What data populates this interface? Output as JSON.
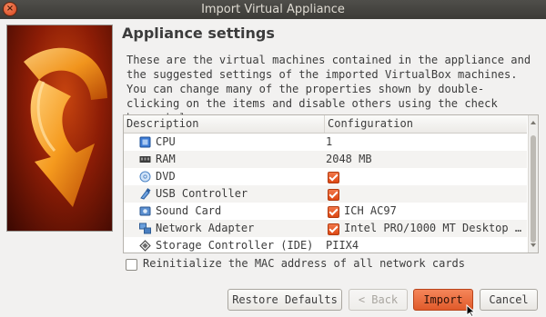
{
  "window": {
    "title": "Import Virtual Appliance",
    "close_glyph": "×"
  },
  "page": {
    "heading": "Appliance settings",
    "description": "These are the virtual machines contained in the appliance and the suggested settings of the imported VirtualBox machines. You can change many of the properties shown by double-clicking on the items and disable others using the check boxes below."
  },
  "table": {
    "columns": [
      "Description",
      "Configuration"
    ],
    "rows": [
      {
        "icon": "cpu-icon",
        "label": "CPU",
        "value": "1",
        "checked": null
      },
      {
        "icon": "ram-icon",
        "label": "RAM",
        "value": "2048 MB",
        "checked": null
      },
      {
        "icon": "dvd-icon",
        "label": "DVD",
        "value": "",
        "checked": true
      },
      {
        "icon": "usb-icon",
        "label": "USB Controller",
        "value": "",
        "checked": true
      },
      {
        "icon": "sound-icon",
        "label": "Sound Card",
        "value": "ICH AC97",
        "checked": true
      },
      {
        "icon": "network-icon",
        "label": "Network Adapter",
        "value": "Intel PRO/1000 MT Desktop …",
        "checked": true
      },
      {
        "icon": "storage-icon",
        "label": "Storage Controller (IDE)",
        "value": "PIIX4",
        "checked": null
      }
    ]
  },
  "options": {
    "reinit_mac_label": "Reinitialize the MAC address of all network cards",
    "reinit_mac_checked": false
  },
  "buttons": {
    "restore": "Restore Defaults",
    "back": "< Back",
    "import": "Import",
    "cancel": "Cancel"
  },
  "colors": {
    "accent": "#dd4814",
    "titlebar": "#3c3b37",
    "background": "#f2f1f0"
  }
}
